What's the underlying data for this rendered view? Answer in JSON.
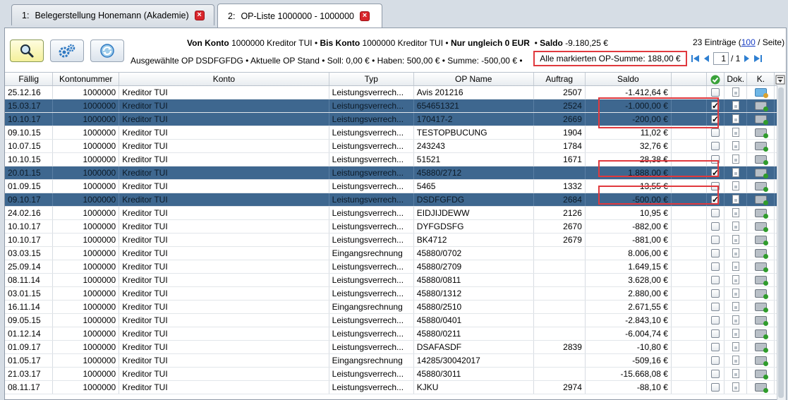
{
  "tabs": [
    {
      "num": "1:",
      "label": "Belegerstellung Honemann (Akademie)",
      "close": "×"
    },
    {
      "num": "2:",
      "label": "OP-Liste 1000000 - 1000000",
      "close": "×"
    }
  ],
  "header": {
    "von_konto_label": "Von Konto",
    "von_konto_value": "1000000 Kreditor TUI",
    "bis_konto_label": "Bis Konto",
    "bis_konto_value": "1000000 Kreditor TUI",
    "nur_ungleich": "Nur ungleich 0 EUR",
    "saldo_label": "Saldo",
    "saldo_value": "-9.180,25 €",
    "sep": "•",
    "summary": "Ausgewählte OP DSDFGFDG • Aktuelle OP Stand • Soll: 0,00 € • Haben: 500,00 € • Summe: -500,00 € •",
    "marked_sum": "Alle markierten OP-Summe: 188,00 €"
  },
  "pager": {
    "entries_prefix": "23 Einträge (",
    "per_page": "100",
    "entries_suffix": " / Seite)",
    "page": "1",
    "total": "/ 1"
  },
  "columns": {
    "faellig": "Fällig",
    "kontonummer": "Kontonummer",
    "konto": "Konto",
    "typ": "Typ",
    "op_name": "OP Name",
    "auftrag": "Auftrag",
    "saldo": "Saldo",
    "dok": "Dok.",
    "k": "K."
  },
  "rows": [
    {
      "faellig": "25.12.16",
      "kontonummer": "1000000",
      "konto": "Kreditor TUI",
      "typ": "Leistungsverrech...",
      "op_name": "Avis 201216",
      "auftrag": "2507",
      "saldo": "-1.412,64 €",
      "checked": false,
      "selected": false
    },
    {
      "faellig": "15.03.17",
      "kontonummer": "1000000",
      "konto": "Kreditor TUI",
      "typ": "Leistungsverrech...",
      "op_name": "654651321",
      "auftrag": "2524",
      "saldo": "-1.000,00 €",
      "checked": true,
      "selected": true
    },
    {
      "faellig": "10.10.17",
      "kontonummer": "1000000",
      "konto": "Kreditor TUI",
      "typ": "Leistungsverrech...",
      "op_name": "170417-2",
      "auftrag": "2669",
      "saldo": "-200,00 €",
      "checked": true,
      "selected": true
    },
    {
      "faellig": "09.10.15",
      "kontonummer": "1000000",
      "konto": "Kreditor TUI",
      "typ": "Leistungsverrech...",
      "op_name": "TESTOPBUCUNG",
      "auftrag": "1904",
      "saldo": "11,02 €",
      "checked": false,
      "selected": false
    },
    {
      "faellig": "10.07.15",
      "kontonummer": "1000000",
      "konto": "Kreditor TUI",
      "typ": "Leistungsverrech...",
      "op_name": "243243",
      "auftrag": "1784",
      "saldo": "32,76 €",
      "checked": false,
      "selected": false
    },
    {
      "faellig": "10.10.15",
      "kontonummer": "1000000",
      "konto": "Kreditor TUI",
      "typ": "Leistungsverrech...",
      "op_name": "51521",
      "auftrag": "1671",
      "saldo": "28,38 €",
      "checked": false,
      "selected": false
    },
    {
      "faellig": "20.01.15",
      "kontonummer": "1000000",
      "konto": "Kreditor TUI",
      "typ": "Leistungsverrech...",
      "op_name": "45880/2712",
      "auftrag": "",
      "saldo": "1.888,00 €",
      "checked": true,
      "selected": true
    },
    {
      "faellig": "01.09.15",
      "kontonummer": "1000000",
      "konto": "Kreditor TUI",
      "typ": "Leistungsverrech...",
      "op_name": "5465",
      "auftrag": "1332",
      "saldo": "13,55 €",
      "checked": false,
      "selected": false
    },
    {
      "faellig": "09.10.17",
      "kontonummer": "1000000",
      "konto": "Kreditor TUI",
      "typ": "Leistungsverrech...",
      "op_name": "DSDFGFDG",
      "auftrag": "2684",
      "saldo": "-500,00 €",
      "checked": true,
      "selected": true
    },
    {
      "faellig": "24.02.16",
      "kontonummer": "1000000",
      "konto": "Kreditor TUI",
      "typ": "Leistungsverrech...",
      "op_name": "EIDJIJDEWW",
      "auftrag": "2126",
      "saldo": "10,95 €",
      "checked": false,
      "selected": false
    },
    {
      "faellig": "10.10.17",
      "kontonummer": "1000000",
      "konto": "Kreditor TUI",
      "typ": "Leistungsverrech...",
      "op_name": "DYFGDSFG",
      "auftrag": "2670",
      "saldo": "-882,00 €",
      "checked": false,
      "selected": false
    },
    {
      "faellig": "10.10.17",
      "kontonummer": "1000000",
      "konto": "Kreditor TUI",
      "typ": "Leistungsverrech...",
      "op_name": "BK4712",
      "auftrag": "2679",
      "saldo": "-881,00 €",
      "checked": false,
      "selected": false
    },
    {
      "faellig": "03.03.15",
      "kontonummer": "1000000",
      "konto": "Kreditor TUI",
      "typ": "Eingangsrechnung",
      "op_name": "45880/0702",
      "auftrag": "",
      "saldo": "8.006,00 €",
      "checked": false,
      "selected": false
    },
    {
      "faellig": "25.09.14",
      "kontonummer": "1000000",
      "konto": "Kreditor TUI",
      "typ": "Leistungsverrech...",
      "op_name": "45880/2709",
      "auftrag": "",
      "saldo": "1.649,15 €",
      "checked": false,
      "selected": false
    },
    {
      "faellig": "08.11.14",
      "kontonummer": "1000000",
      "konto": "Kreditor TUI",
      "typ": "Leistungsverrech...",
      "op_name": "45880/0811",
      "auftrag": "",
      "saldo": "3.628,00 €",
      "checked": false,
      "selected": false
    },
    {
      "faellig": "03.01.15",
      "kontonummer": "1000000",
      "konto": "Kreditor TUI",
      "typ": "Leistungsverrech...",
      "op_name": "45880/1312",
      "auftrag": "",
      "saldo": "2.880,00 €",
      "checked": false,
      "selected": false
    },
    {
      "faellig": "16.11.14",
      "kontonummer": "1000000",
      "konto": "Kreditor TUI",
      "typ": "Eingangsrechnung",
      "op_name": "45880/2510",
      "auftrag": "",
      "saldo": "2.671,55 €",
      "checked": false,
      "selected": false
    },
    {
      "faellig": "09.05.15",
      "kontonummer": "1000000",
      "konto": "Kreditor TUI",
      "typ": "Leistungsverrech...",
      "op_name": "45880/0401",
      "auftrag": "",
      "saldo": "-2.843,10 €",
      "checked": false,
      "selected": false
    },
    {
      "faellig": "01.12.14",
      "kontonummer": "1000000",
      "konto": "Kreditor TUI",
      "typ": "Leistungsverrech...",
      "op_name": "45880/0211",
      "auftrag": "",
      "saldo": "-6.004,74 €",
      "checked": false,
      "selected": false
    },
    {
      "faellig": "01.09.17",
      "kontonummer": "1000000",
      "konto": "Kreditor TUI",
      "typ": "Leistungsverrech...",
      "op_name": "DSAFASDF",
      "auftrag": "2839",
      "saldo": "-10,80 €",
      "checked": false,
      "selected": false
    },
    {
      "faellig": "01.05.17",
      "kontonummer": "1000000",
      "konto": "Kreditor TUI",
      "typ": "Eingangsrechnung",
      "op_name": "14285/30042017",
      "auftrag": "",
      "saldo": "-509,16 €",
      "checked": false,
      "selected": false
    },
    {
      "faellig": "21.03.17",
      "kontonummer": "1000000",
      "konto": "Kreditor TUI",
      "typ": "Leistungsverrech...",
      "op_name": "45880/3011",
      "auftrag": "",
      "saldo": "-15.668,08 €",
      "checked": false,
      "selected": false
    },
    {
      "faellig": "08.11.17",
      "kontonummer": "1000000",
      "konto": "Kreditor TUI",
      "typ": "Leistungsverrech...",
      "op_name": "KJKU",
      "auftrag": "2974",
      "saldo": "-88,10 €",
      "checked": false,
      "selected": false
    }
  ],
  "checkmark": "✓",
  "icons": {
    "search": "search-icon",
    "settings": "gears-icon",
    "refresh": "refresh-icon",
    "check_all": "green-check-icon",
    "column_menu": "column-menu-icon"
  },
  "colors": {
    "selected_row": "#3e678f",
    "highlight": "#e0393e",
    "tab_close": "#d9262c",
    "pager_arrow": "#2e7fd1",
    "link": "#1a3fc4"
  }
}
